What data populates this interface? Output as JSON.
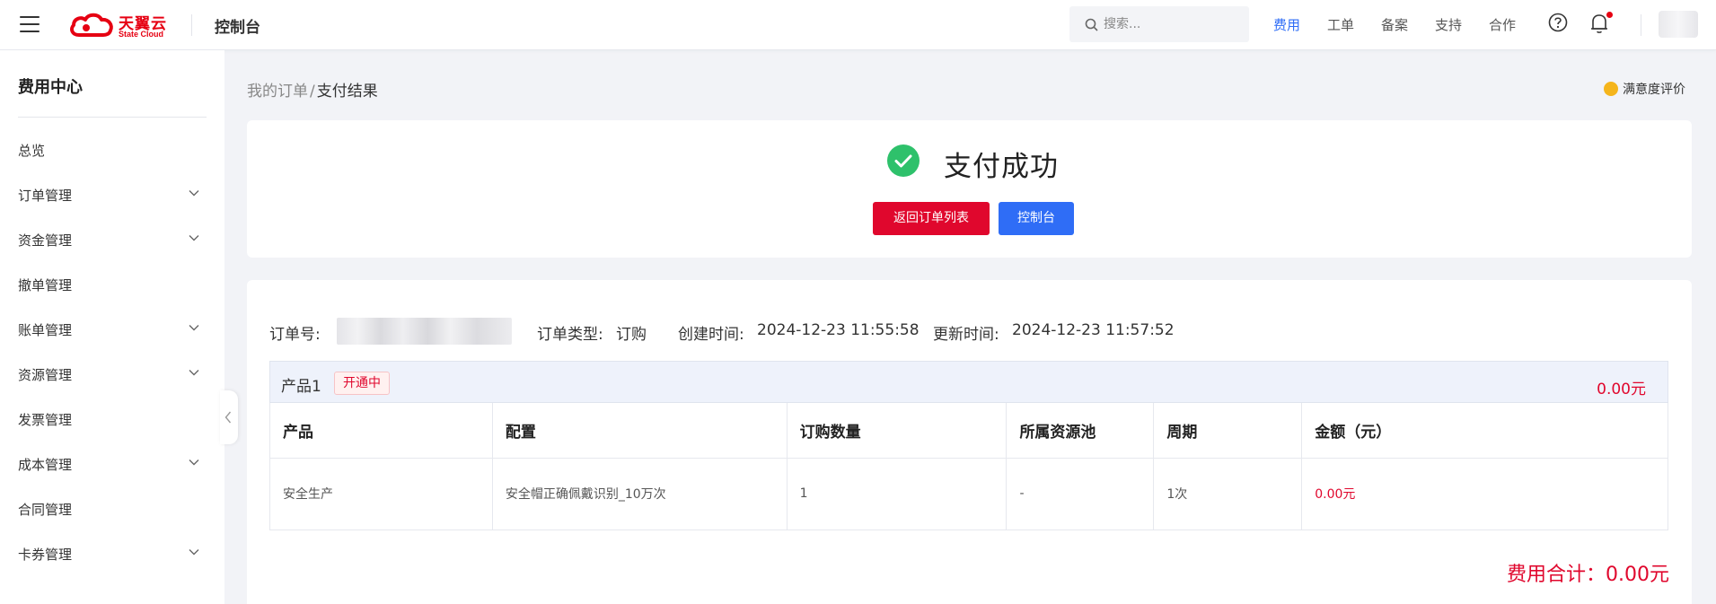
{
  "header": {
    "logo_cn": "天翼云",
    "logo_en": "State Cloud",
    "console_title": "控制台",
    "search_placeholder": "搜索...",
    "nav": [
      {
        "label": "费用",
        "active": true
      },
      {
        "label": "工单",
        "active": false
      },
      {
        "label": "备案",
        "active": false
      },
      {
        "label": "支持",
        "active": false
      },
      {
        "label": "合作",
        "active": false
      }
    ],
    "icons": [
      "menu-icon",
      "search-icon",
      "help-icon",
      "bell-icon",
      "avatar"
    ],
    "brand_color": "#e60012",
    "accent_color": "#2f6df6"
  },
  "sidebar": {
    "title": "费用中心",
    "items": [
      {
        "label": "总览",
        "expandable": false
      },
      {
        "label": "订单管理",
        "expandable": true
      },
      {
        "label": "资金管理",
        "expandable": true
      },
      {
        "label": "撤单管理",
        "expandable": false
      },
      {
        "label": "账单管理",
        "expandable": true
      },
      {
        "label": "资源管理",
        "expandable": true
      },
      {
        "label": "发票管理",
        "expandable": false
      },
      {
        "label": "成本管理",
        "expandable": true
      },
      {
        "label": "合同管理",
        "expandable": false
      },
      {
        "label": "卡券管理",
        "expandable": true
      }
    ]
  },
  "breadcrumb": {
    "parent": "我的订单",
    "separator": "/",
    "current": "支付结果"
  },
  "feedback": {
    "label": "满意度评价"
  },
  "result": {
    "title": "支付成功",
    "status_color": "#2ec16b",
    "back_button": "返回订单列表",
    "console_button": "控制台"
  },
  "order": {
    "order_no_label": "订单号:",
    "type_label": "订单类型:",
    "type_value": "订购",
    "created_label": "创建时间:",
    "created_value": "2024-12-23 11:55:58",
    "updated_label": "更新时间:",
    "updated_value": "2024-12-23 11:57:52",
    "product": {
      "name": "产品1",
      "status": "开通中",
      "amount": "0.00元"
    },
    "table": {
      "headers": [
        "产品",
        "配置",
        "订购数量",
        "所属资源池",
        "周期",
        "金额（元）"
      ],
      "rows": [
        [
          "安全生产",
          "安全帽正确佩戴识别_10万次",
          "1",
          "-",
          "1次",
          "0.00元"
        ]
      ]
    },
    "total": "费用合计：0.00元"
  }
}
